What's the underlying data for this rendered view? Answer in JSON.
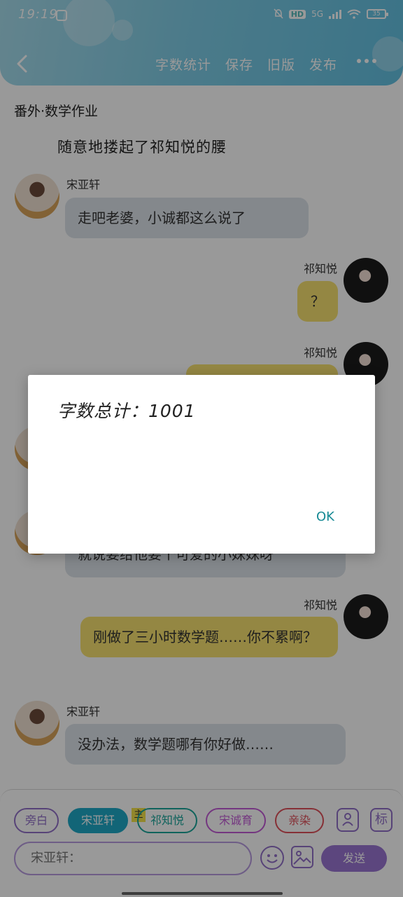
{
  "status_bar": {
    "time": "19:19",
    "hd_label": "HD",
    "network_label": "5G",
    "battery_level": "35"
  },
  "header": {
    "actions": [
      "字数统计",
      "保存",
      "旧版",
      "发布"
    ]
  },
  "story": {
    "chapter_title": "番外·数学作业",
    "narration": "随意地搂起了祁知悦的腰",
    "messages": [
      {
        "name": "宋亚轩",
        "text": "走吧老婆，小诚都这么说了"
      },
      {
        "name": "祁知悦",
        "text": "？"
      },
      {
        "name": "祁知悦",
        "text": ""
      },
      {
        "name": "",
        "text": ""
      },
      {
        "name": "",
        "text": "就说要给他要个可爱的小妹妹呀"
      },
      {
        "name": "祁知悦",
        "text": "刚做了三小时数学题……你不累啊？"
      },
      {
        "name": "宋亚轩",
        "text": "没办法，数学题哪有你好做……"
      }
    ]
  },
  "composer": {
    "roles": [
      "旁白",
      "宋亚轩",
      "祁知悦",
      "宋诚育",
      "亲染"
    ],
    "badge": "主",
    "input_text": "宋亚轩：",
    "send_label": "发送",
    "tag_label": "标"
  },
  "dialog": {
    "message": "字数总计：1001",
    "ok_label": "OK"
  },
  "colors": {
    "header_accent": "#63c1e2",
    "left_bubble": "#dde3ea",
    "right_bubble": "#f7e270",
    "send_button": "#9a76d2",
    "dialog_ok": "#178a95"
  }
}
